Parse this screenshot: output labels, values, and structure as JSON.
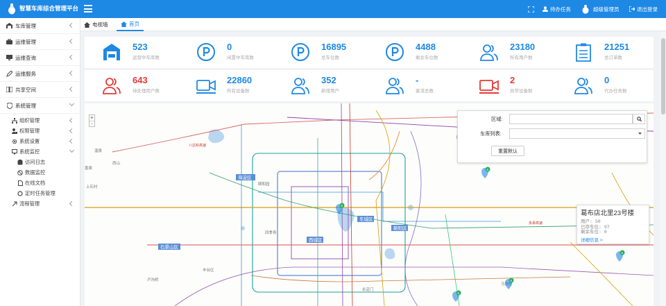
{
  "app": {
    "title": "智慧车库综合管理平台"
  },
  "topbar": {
    "tasks": "待办任务",
    "user": "超级管理员",
    "logout": "退出登录"
  },
  "sidebar": {
    "items": [
      {
        "label": "车库管理",
        "icon": "garage-icon"
      },
      {
        "label": "运维管理",
        "icon": "briefcase-icon"
      },
      {
        "label": "运维查询",
        "icon": "monitor-icon"
      },
      {
        "label": "运维服务",
        "icon": "pencil-icon"
      },
      {
        "label": "共享空间",
        "icon": "book-icon"
      },
      {
        "label": "系统管理",
        "icon": "shield-icon"
      }
    ],
    "sub": [
      {
        "label": "组织管理",
        "icon": "sitemap-icon"
      },
      {
        "label": "权限管理",
        "icon": "user-lock-icon"
      },
      {
        "label": "系统设置",
        "icon": "gear-icon"
      },
      {
        "label": "系统监控",
        "icon": "desktop-icon"
      }
    ],
    "subsub": [
      {
        "label": "访问日志",
        "icon": "log-icon"
      },
      {
        "label": "数据监控",
        "icon": "ban-icon"
      },
      {
        "label": "在线文档",
        "icon": "doc-icon"
      },
      {
        "label": "定时任务管理",
        "icon": "circle-icon"
      }
    ],
    "last": {
      "label": "流程管理",
      "icon": "flow-icon"
    }
  },
  "tabs": [
    {
      "label": "电视墙"
    },
    {
      "label": "首页"
    }
  ],
  "stats_row1": [
    {
      "value": "523",
      "label": "运营中车库数",
      "icon": "garage-icon"
    },
    {
      "value": "0",
      "label": "闲置中车库数",
      "icon": "parking-icon"
    },
    {
      "value": "16895",
      "label": "总车位数",
      "icon": "parking-icon"
    },
    {
      "value": "4488",
      "label": "剩余车位数",
      "icon": "parking-icon"
    },
    {
      "value": "23180",
      "label": "所有用户数",
      "icon": "users-icon"
    },
    {
      "value": "21251",
      "label": "总订单数",
      "icon": "clipboard-icon"
    }
  ],
  "stats_row2": [
    {
      "value": "643",
      "label": "待处理用户数",
      "icon": "users-icon",
      "color": "#e53935"
    },
    {
      "value": "22860",
      "label": "所有设备数",
      "icon": "video-icon",
      "color": "#1e88e5"
    },
    {
      "value": "352",
      "label": "新增用户",
      "icon": "users-icon",
      "color": "#1e88e5"
    },
    {
      "value": "-",
      "label": "客流总数",
      "icon": "users-icon",
      "color": "#1e88e5"
    },
    {
      "value": "2",
      "label": "异常设备数",
      "icon": "video-icon",
      "color": "#e53935"
    },
    {
      "value": "0",
      "label": "代办任务数",
      "icon": "users-icon",
      "color": "#1e88e5"
    }
  ],
  "filter": {
    "region_label": "区域:",
    "garage_label": "车库列表:",
    "reset": "重置默认"
  },
  "popup": {
    "title": "葛布店北里23号楼",
    "lines": [
      "用户: 50",
      "已存车位: 97",
      "剩余车位: 0"
    ],
    "link": "详细信息 >"
  },
  "map": {
    "districts": [
      "海淀区",
      "东城区",
      "朝阳区",
      "西城区",
      "石景山区"
    ],
    "places": [
      "温泉",
      "西山",
      "香泉",
      "上石村",
      "颐和园",
      "四季青",
      "丰台区",
      "卢沟桥",
      "永定门",
      "马驹桥"
    ],
    "road_labels": [
      "八达岭高速",
      "京承高速"
    ],
    "markers": [
      "6",
      "6",
      "6",
      "6",
      "6",
      "6"
    ],
    "zoom": {
      "in": "+",
      "out": "-"
    }
  },
  "colors": {
    "primary": "#1e88e5",
    "danger": "#e53935"
  }
}
